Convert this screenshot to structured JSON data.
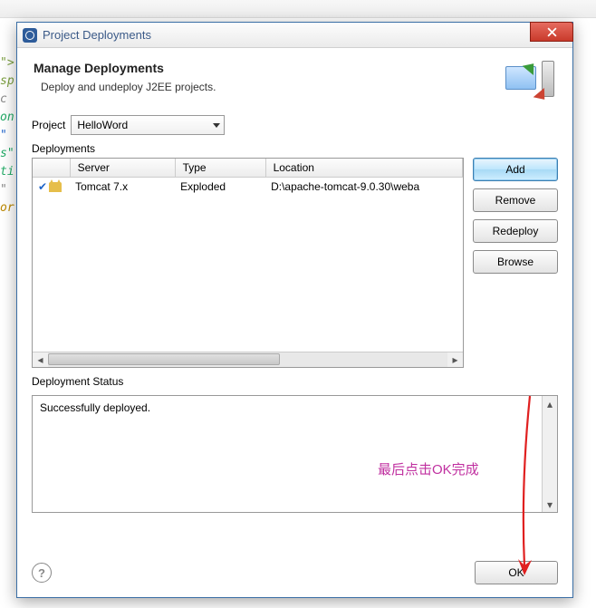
{
  "window": {
    "title": "Project Deployments"
  },
  "header": {
    "title": "Manage Deployments",
    "subtitle": "Deploy and undeploy J2EE projects."
  },
  "project": {
    "label": "Project",
    "selected": "HelloWord"
  },
  "deployments": {
    "section_label": "Deployments",
    "columns": {
      "server": "Server",
      "type": "Type",
      "location": "Location"
    },
    "rows": [
      {
        "server": "Tomcat  7.x",
        "type": "Exploded",
        "location": "D:\\apache-tomcat-9.0.30\\weba"
      }
    ]
  },
  "buttons": {
    "add": "Add",
    "remove": "Remove",
    "redeploy": "Redeploy",
    "browse": "Browse",
    "ok": "OK"
  },
  "status": {
    "label": "Deployment Status",
    "text": "Successfully deployed."
  },
  "annotation": "最后点击OK完成",
  "help": "?"
}
